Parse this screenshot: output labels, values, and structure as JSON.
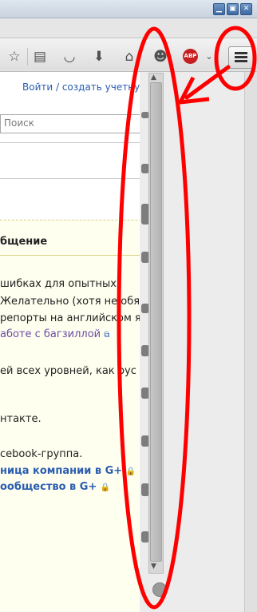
{
  "toolbar": {
    "icons": [
      "star-icon",
      "reading-list-icon",
      "pocket-icon",
      "download-icon",
      "home-icon",
      "chat-icon",
      "adblock-icon",
      "menu-icon"
    ],
    "adblock_label": "ABP"
  },
  "page": {
    "login_text": "Войти / создать учетную",
    "search_placeholder": "Поиск",
    "section_heading": "бщение",
    "lines": [
      "шибках для опытных",
      "Желательно (хотя не обя",
      "репорты на английском я",
      "аботе с багзиллой",
      "ей всех уровней, как рус",
      "нтакте.",
      "cebook-группа.",
      "ница компании в G+",
      "ообщество в G+"
    ]
  },
  "colors": {
    "annotation": "#ff0000",
    "link": "#2a5db0",
    "visited_link": "#6b4ba1",
    "adblock": "#c61f1f"
  }
}
